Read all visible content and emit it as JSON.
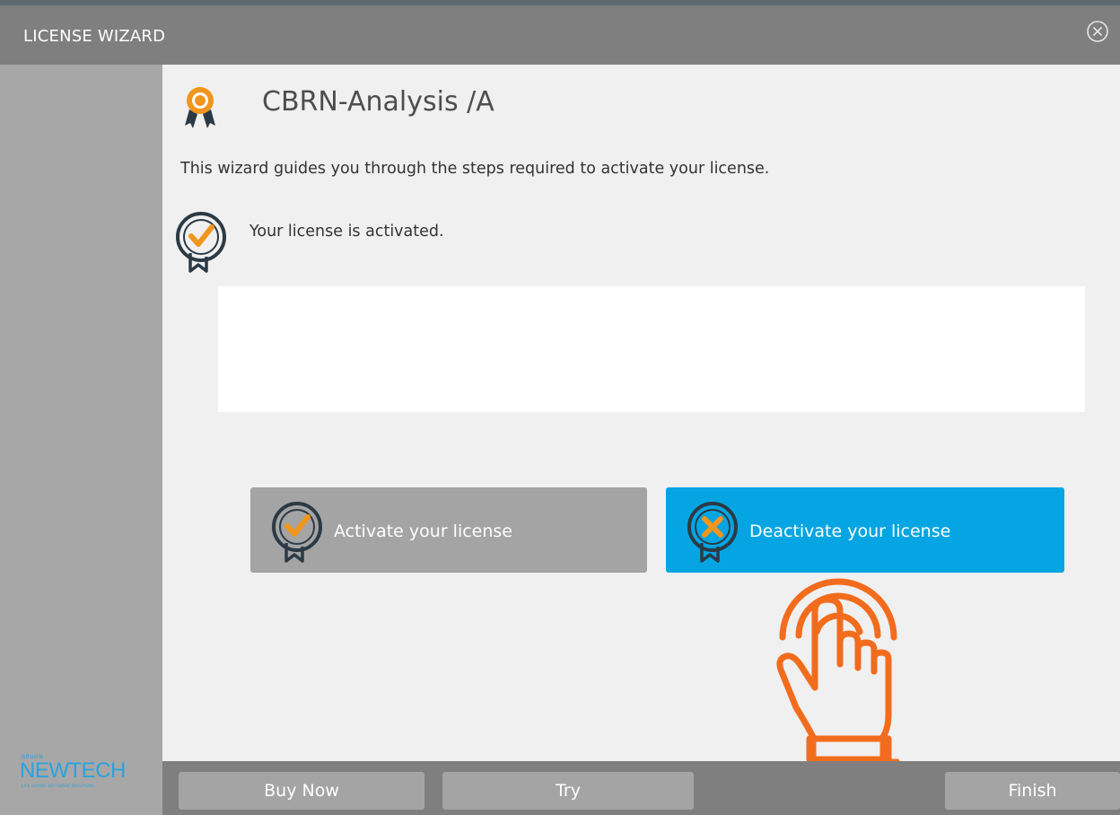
{
  "window": {
    "title": "LICENSE WIZARD"
  },
  "product": {
    "name": "CBRN-Analysis /A"
  },
  "intro_text": "This wizard guides you through the steps required to activate your license.",
  "status": {
    "text": "Your license is activated."
  },
  "message_box": {
    "text": ""
  },
  "actions": {
    "activate_label": "Activate your license",
    "deactivate_label": "Deactivate your license"
  },
  "footer": {
    "buy_label": "Buy Now",
    "try_label": "Try",
    "finish_label": "Finish"
  },
  "branding": {
    "small_text": "BRUHN",
    "logo_text": "NEWTECH",
    "tagline": "LIFE SAVING SOFTWARE SOLUTIONS"
  },
  "colors": {
    "title_bar": "#7f7f7f",
    "sidebar": "#a7a7a7",
    "content_bg": "#f0f0f0",
    "deactivate_button": "#04a5e2",
    "activate_button": "#a4a4a4",
    "accent_orange": "#f0961e",
    "hand_orange": "#f26c1d",
    "icon_dark": "#2b3a45"
  },
  "icons": {
    "close": "close-circle-icon",
    "product": "award-ribbon-icon",
    "status": "badge-check-icon",
    "activate": "badge-check-icon",
    "deactivate": "badge-x-icon",
    "overlay": "tap-hand-icon"
  }
}
